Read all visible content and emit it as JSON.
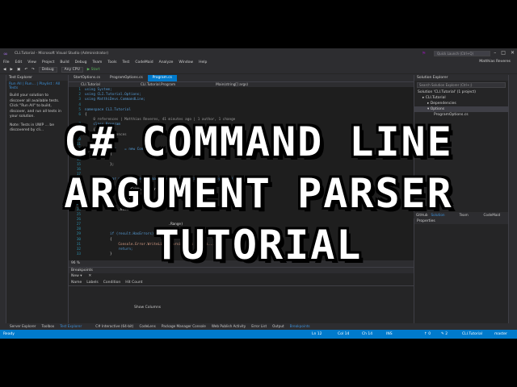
{
  "window": {
    "title": "CLI.Tutorial - Microsoft Visual Studio (Administrator)",
    "quick_launch_placeholder": "Quick Launch (Ctrl+Q)",
    "user": "Matthias Reveres"
  },
  "menu": [
    "File",
    "Edit",
    "View",
    "Project",
    "Build",
    "Debug",
    "Team",
    "Tools",
    "Test",
    "CodeMaid",
    "Analyze",
    "Window",
    "Help"
  ],
  "toolbar": {
    "config": "Debug",
    "platform": "Any CPU",
    "start": "▶ Start"
  },
  "test_explorer": {
    "title": "Test Explorer",
    "run_all": "Run All",
    "run": "Run...",
    "playlist": "Playlist : All Tests",
    "message": "Build your solution to discover all available tests. Click \"Run All\" to build, discover, and run all tests in your solution.",
    "note": "Note: Tests in UWP ... be discovered by cli..."
  },
  "editor": {
    "tabs": [
      "StartOptions.cs",
      "ProgramOptions.cs",
      "Program.cs"
    ],
    "active_tab": "Program.cs",
    "nav": [
      "CLI.Tutorial",
      "CLI.Tutorial.Program",
      "Main(string[] args)"
    ],
    "zoom": "96 %",
    "lines": [
      {
        "n": "1",
        "t": "using System;"
      },
      {
        "n": "2",
        "t": "using CLI.Tutorial.Options;"
      },
      {
        "n": "3",
        "t": "using MatthiDevs.CommandLine;"
      },
      {
        "n": "4",
        "t": ""
      },
      {
        "n": "5",
        "t": "namespace CLI.Tutorial"
      },
      {
        "n": "6",
        "t": "{"
      },
      {
        "n": "",
        "t": "    0 references | Matthias Reveres, 41 minutes ago | 1 author, 1 change"
      },
      {
        "n": "7",
        "t": "    class Program"
      },
      {
        "n": "8",
        "t": "    {"
      },
      {
        "n": "9",
        "t": "        0 references"
      },
      {
        "n": "10",
        "t": "        static v"
      },
      {
        "n": "11",
        "t": "        {"
      },
      {
        "n": "12",
        "t": "            var    = new Comm"
      },
      {
        "n": "13",
        "t": "            {"
      },
      {
        "n": "14",
        "t": ""
      },
      {
        "n": "15",
        "t": "            };"
      },
      {
        "n": "16",
        "t": ""
      },
      {
        "n": "17",
        "t": ""
      },
      {
        "n": "18",
        "t": "            var parser = new CommandLineParser<ProgramOptions>(options);"
      },
      {
        "n": "19",
        "t": ""
      },
      {
        "n": "20",
        "t": "            parser.AddCommand<StartOptions>()"
      },
      {
        "n": "21",
        "t": "                .Name(\"start\")"
      },
      {
        "n": "22",
        "t": "                .Required(true)"
      },
      {
        "n": "23",
        "t": "                .Script"
      },
      {
        "n": "24",
        "t": "                .Execut"
      },
      {
        "n": "25",
        "t": ""
      },
      {
        "n": "26",
        "t": ""
      },
      {
        "n": "27",
        "t": "                                        .Range)"
      },
      {
        "n": "28",
        "t": ""
      },
      {
        "n": "29",
        "t": "            if (result.HasErrors)"
      },
      {
        "n": "30",
        "t": "            {"
      },
      {
        "n": "31",
        "t": "                Console.Error.WriteLine(\"Parsing has errors...\");"
      },
      {
        "n": "32",
        "t": "                return;"
      },
      {
        "n": "33",
        "t": "            }"
      }
    ]
  },
  "breakpoints": {
    "title": "Breakpoints",
    "new": "New ▾",
    "columns": [
      "Name",
      "Labels",
      "Condition",
      "Hit Count"
    ],
    "show_columns": "Show Columns"
  },
  "solution_explorer": {
    "title": "Solution Explorer",
    "search_placeholder": "Search Solution Explorer (Ctrl+;)",
    "items": [
      "Solution 'CLI.Tutorial' (1 project)",
      "▸ CLI.Tutorial",
      "▸ Dependencies",
      "▾ Options",
      "ProgramOptions.cs"
    ],
    "tabs": [
      "GitHub",
      "Solution Explorer",
      "Team Explorer",
      "CodeMaid Spade"
    ],
    "active_tab": "Solution Explorer",
    "properties": "Properties"
  },
  "tool_tabs": {
    "left": [
      "Server Explorer",
      "Toolbox",
      "Test Explorer"
    ],
    "right": [
      "C# Interactive (64-bit)",
      "CodeLens",
      "Package Manager Console",
      "Web Publish Activity",
      "Error List",
      "Output",
      "Breakpoints"
    ],
    "active_left": "Test Explorer",
    "active_right": "Breakpoints"
  },
  "status": {
    "ready": "Ready",
    "ln": "Ln 12",
    "col": "Col 14",
    "ch": "Ch 14",
    "ins": "INS",
    "errors": "↑ 0",
    "changes": "✎ 2",
    "repo": "CLI.Tutorial",
    "branch": "master"
  },
  "overlay": {
    "line1": "C# COMMAND LINE",
    "line2": "ARGUMENT PARSER",
    "line3": "TUTORIAL"
  },
  "colors": {
    "accent": "#007acc",
    "ide_bg": "#2d2d30",
    "editor_bg": "#1e1e1e",
    "overlay_text": "#ffffff"
  }
}
